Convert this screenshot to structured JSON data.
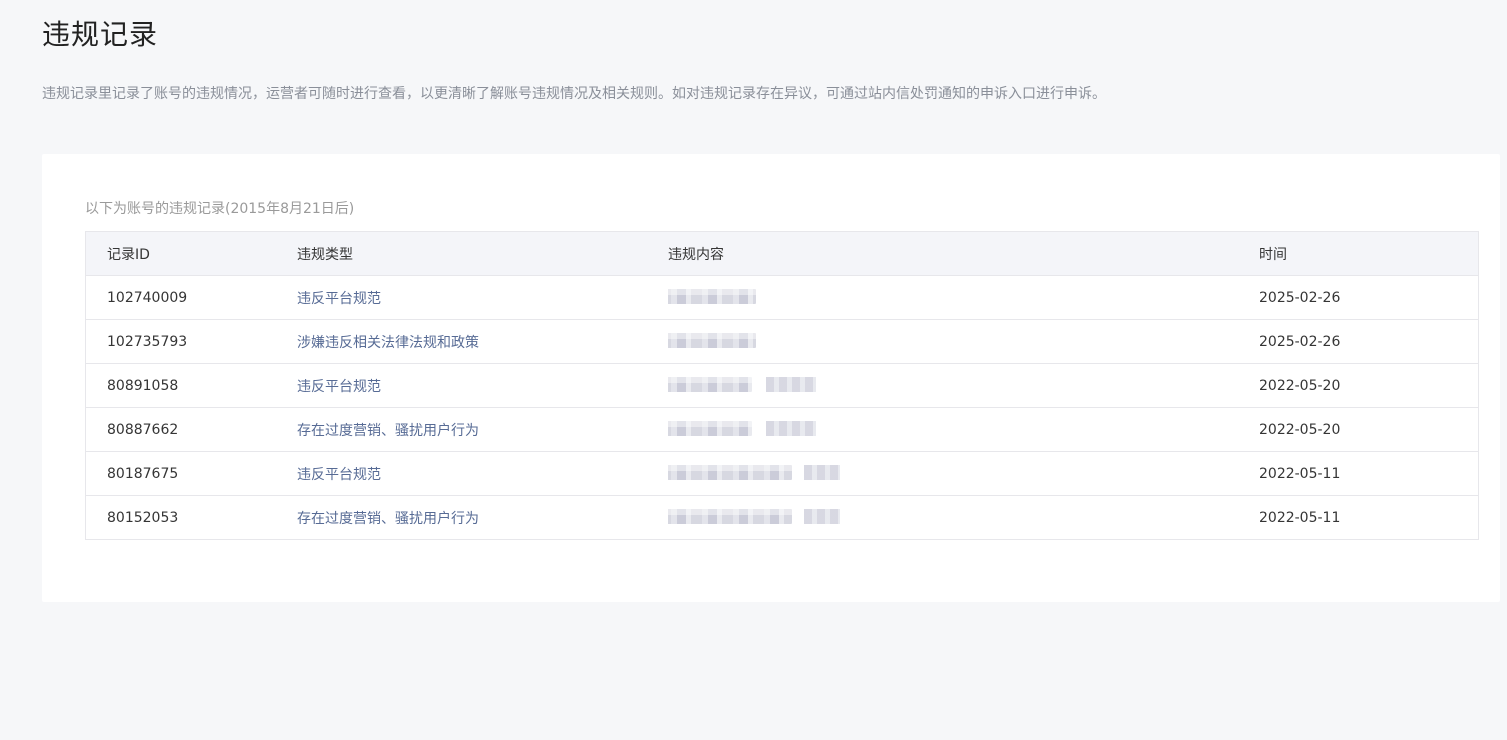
{
  "page": {
    "title": "违规记录",
    "description": "违规记录里记录了账号的违规情况，运营者可随时进行查看，以更清晰了解账号违规情况及相关规则。如对违规记录存在异议，可通过站内信处罚通知的申诉入口进行申诉。"
  },
  "table": {
    "caption": "以下为账号的违规记录(2015年8月21日后)",
    "headers": {
      "id": "记录ID",
      "type": "违规类型",
      "content": "违规内容",
      "time": "时间"
    },
    "rows": [
      {
        "id": "102740009",
        "type": "违反平台规范",
        "time": "2025-02-26"
      },
      {
        "id": "102735793",
        "type": "涉嫌违反相关法律法规和政策",
        "time": "2025-02-26"
      },
      {
        "id": "80891058",
        "type": "违反平台规范",
        "time": "2022-05-20"
      },
      {
        "id": "80887662",
        "type": "存在过度营销、骚扰用户行为",
        "time": "2022-05-20"
      },
      {
        "id": "80187675",
        "type": "违反平台规范",
        "time": "2022-05-11"
      },
      {
        "id": "80152053",
        "type": "存在过度营销、骚扰用户行为",
        "time": "2022-05-11"
      }
    ]
  },
  "colors": {
    "link": "#576b95",
    "header_bg": "#f4f5f9",
    "border": "#e7e7eb",
    "page_bg": "#f6f7f9"
  }
}
